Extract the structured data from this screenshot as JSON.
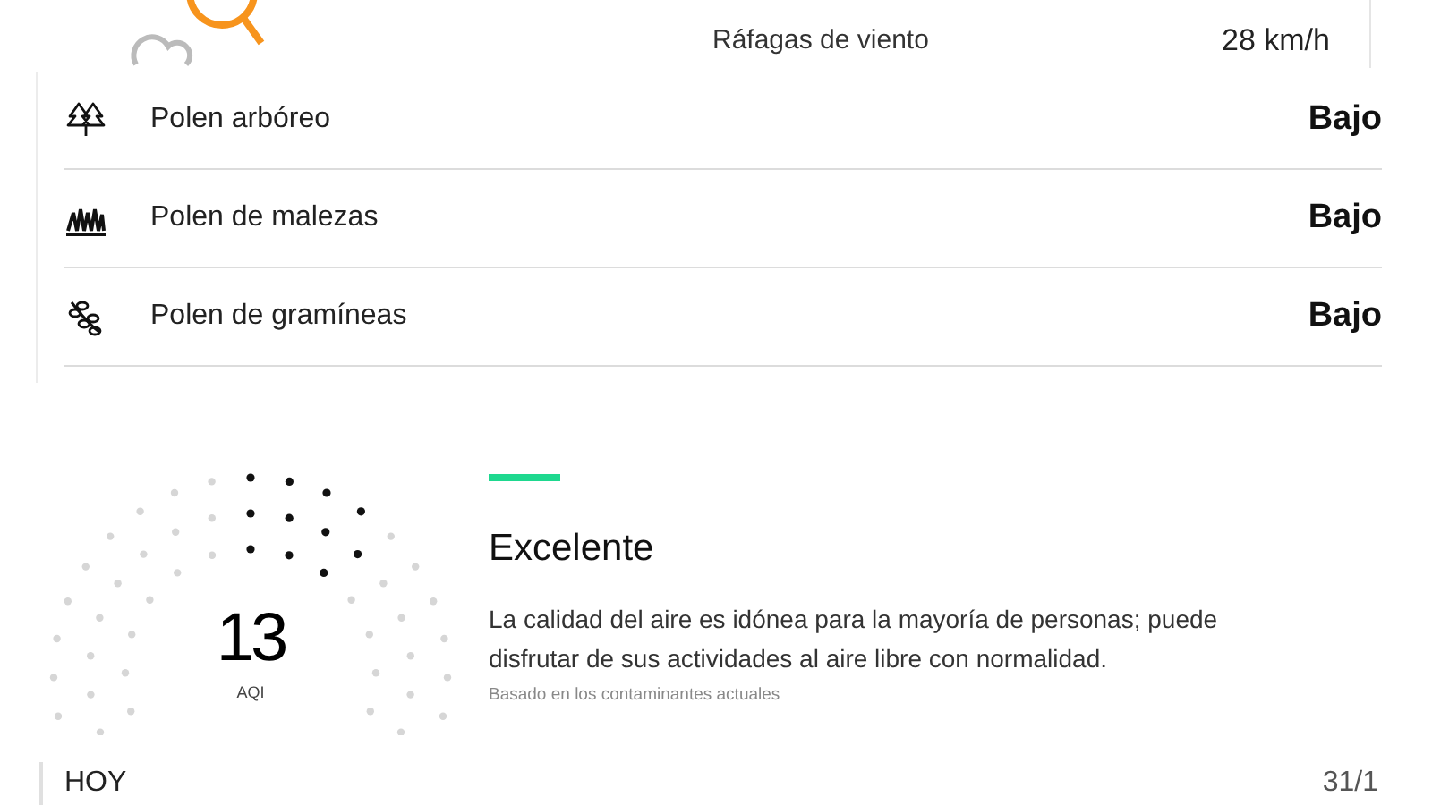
{
  "top_detail": {
    "label": "Ráfagas de viento",
    "value": "28 km/h"
  },
  "pollen": [
    {
      "kind": "tree",
      "label": "Polen arbóreo",
      "value": "Bajo"
    },
    {
      "kind": "weed",
      "label": "Polen de malezas",
      "value": "Bajo"
    },
    {
      "kind": "grass",
      "label": "Polen de gramíneas",
      "value": "Bajo"
    }
  ],
  "air_quality": {
    "value": "13",
    "unit": "AQI",
    "color": "#1ed88f",
    "title": "Excelente",
    "description": "La calidad del aire es idónea para la mayoría de personas; puede disfrutar de sus actividades al aire libre con normalidad.",
    "note": "Basado en los contaminantes actuales"
  },
  "footer": {
    "label": "HOY",
    "date": "31/1"
  }
}
